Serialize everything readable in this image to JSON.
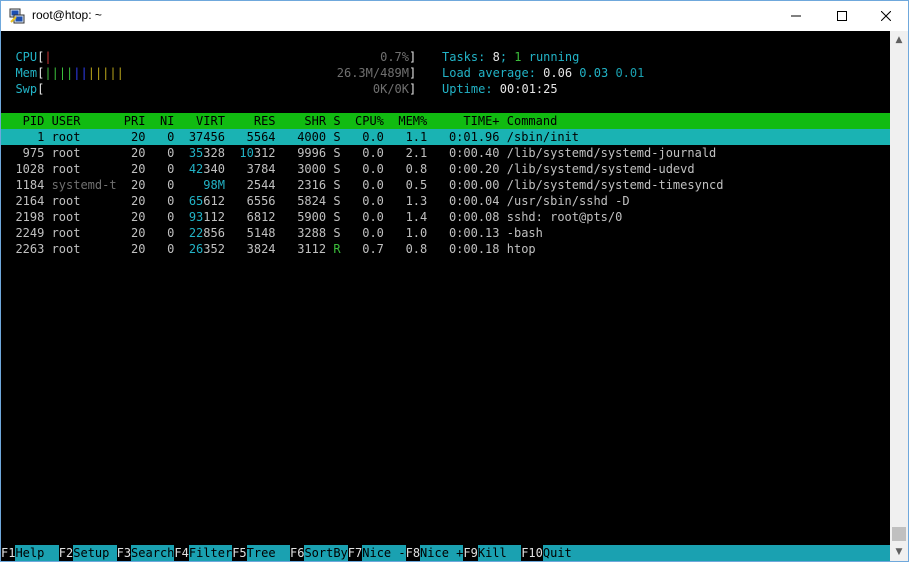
{
  "window": {
    "title": "root@htop: ~"
  },
  "meters": {
    "cpu": {
      "label": "CPU",
      "value": "0.7%",
      "bar": "|"
    },
    "mem": {
      "label": "Mem",
      "value": "26.3M/489M",
      "bar": "|||||||||||"
    },
    "swp": {
      "label": "Swp",
      "value": "0K/0K"
    },
    "tasks": {
      "label": "Tasks: ",
      "count": "8",
      "sep": "; ",
      "running": "1",
      "running_label": " running"
    },
    "load": {
      "label": "Load average: ",
      "v1": "0.06",
      "v5": "0.03",
      "v15": "0.01"
    },
    "uptime": {
      "label": "Uptime: ",
      "value": "00:01:25"
    }
  },
  "columns": [
    "PID",
    "USER",
    "PRI",
    "NI",
    "VIRT",
    "RES",
    "SHR",
    "S",
    "CPU%",
    "MEM%",
    "TIME+",
    "Command"
  ],
  "processes": [
    {
      "pid": "1",
      "user": "root",
      "pri": "20",
      "ni": "0",
      "virt": "37456",
      "res": "5564",
      "shr": "4000",
      "s": "S",
      "cpu": "0.0",
      "mem": "1.1",
      "time": "0:01.96",
      "cmd": "/sbin/init"
    },
    {
      "pid": "975",
      "user": "root",
      "pri": "20",
      "ni": "0",
      "virt": "35328",
      "res": "10312",
      "shr": "9996",
      "s": "S",
      "cpu": "0.0",
      "mem": "2.1",
      "time": "0:00.40",
      "cmd": "/lib/systemd/systemd-journald"
    },
    {
      "pid": "1028",
      "user": "root",
      "pri": "20",
      "ni": "0",
      "virt": "42340",
      "res": "3784",
      "shr": "3000",
      "s": "S",
      "cpu": "0.0",
      "mem": "0.8",
      "time": "0:00.20",
      "cmd": "/lib/systemd/systemd-udevd"
    },
    {
      "pid": "1184",
      "user": "systemd-t",
      "pri": "20",
      "ni": "0",
      "virt": "98M",
      "res": "2544",
      "shr": "2316",
      "s": "S",
      "cpu": "0.0",
      "mem": "0.5",
      "time": "0:00.00",
      "cmd": "/lib/systemd/systemd-timesyncd"
    },
    {
      "pid": "2164",
      "user": "root",
      "pri": "20",
      "ni": "0",
      "virt": "65612",
      "res": "6556",
      "shr": "5824",
      "s": "S",
      "cpu": "0.0",
      "mem": "1.3",
      "time": "0:00.04",
      "cmd": "/usr/sbin/sshd -D"
    },
    {
      "pid": "2198",
      "user": "root",
      "pri": "20",
      "ni": "0",
      "virt": "93112",
      "res": "6812",
      "shr": "5900",
      "s": "S",
      "cpu": "0.0",
      "mem": "1.4",
      "time": "0:00.08",
      "cmd": "sshd: root@pts/0"
    },
    {
      "pid": "2249",
      "user": "root",
      "pri": "20",
      "ni": "0",
      "virt": "22856",
      "res": "5148",
      "shr": "3288",
      "s": "S",
      "cpu": "0.0",
      "mem": "1.0",
      "time": "0:00.13",
      "cmd": "-bash"
    },
    {
      "pid": "2263",
      "user": "root",
      "pri": "20",
      "ni": "0",
      "virt": "26352",
      "res": "3824",
      "shr": "3112",
      "s": "R",
      "cpu": "0.7",
      "mem": "0.8",
      "time": "0:00.18",
      "cmd": "htop"
    }
  ],
  "function_keys": [
    {
      "key": "F1",
      "label": "Help  "
    },
    {
      "key": "F2",
      "label": "Setup "
    },
    {
      "key": "F3",
      "label": "Search"
    },
    {
      "key": "F4",
      "label": "Filter"
    },
    {
      "key": "F5",
      "label": "Tree  "
    },
    {
      "key": "F6",
      "label": "SortBy"
    },
    {
      "key": "F7",
      "label": "Nice -"
    },
    {
      "key": "F8",
      "label": "Nice +"
    },
    {
      "key": "F9",
      "label": "Kill  "
    },
    {
      "key": "F10",
      "label": "Quit"
    }
  ],
  "colors": {
    "header_bg": "#11bb11",
    "selected_bg": "#1ab3b3",
    "footer_bg": "#1aa1b1"
  }
}
